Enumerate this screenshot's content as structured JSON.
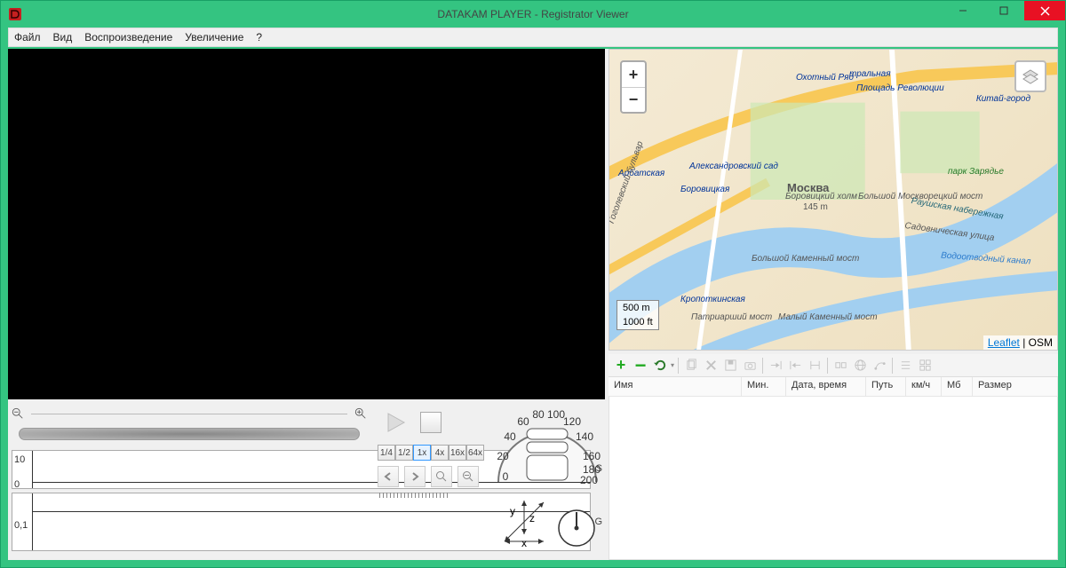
{
  "window": {
    "title": "DATAKAM PLAYER - Registrator Viewer"
  },
  "menu": {
    "items": [
      "Файл",
      "Вид",
      "Воспроизведение",
      "Увеличение",
      "?"
    ]
  },
  "playback": {
    "speeds": [
      "1/4",
      "1/2",
      "1x",
      "4x",
      "16x",
      "64x"
    ],
    "active_speed_index": 2
  },
  "speedometer": {
    "ticks": [
      "0",
      "20",
      "40",
      "60",
      "80",
      "100",
      "120",
      "140",
      "160",
      "180",
      "200"
    ]
  },
  "axes": {
    "x": "x",
    "y": "y",
    "z": "z"
  },
  "graphs": {
    "s": {
      "label": "S",
      "y_ticks": [
        "10",
        "0"
      ]
    },
    "g": {
      "label": "G",
      "y_ticks": [
        "0,1"
      ]
    }
  },
  "map": {
    "zoom_in": "+",
    "zoom_out": "−",
    "scale_metric": "500 m",
    "scale_imperial": "1000 ft",
    "attribution_link": "Leaflet",
    "attribution_sep": " | ",
    "attribution_text": "OSM",
    "labels": {
      "ohotny": "Охотный Ряд",
      "tralnaya": "тральная",
      "revolution": "Площадь Революции",
      "kitay": "Китай-город",
      "arbat": "Арбатская",
      "aleks": "Александровский сад",
      "borov": "Боровицкая",
      "moscow": "Москва",
      "borhill": "Боровицкий холм",
      "borhill_h": "145 m",
      "bolshmosk": "Большой Москворецкий мост",
      "raush": "Раушская набережная",
      "zaryadye": "парк Зарядье",
      "sadov": "Садовническая улица",
      "vodoot": "Водоотводный канал",
      "kropot": "Кропоткинская",
      "bolshkam": "Большой Каменный мост",
      "patr": "Патриарший мост",
      "malkam": "Малый Каменный мост",
      "gogol": "Гоголевский бульвар"
    }
  },
  "toolbar": {
    "add": "+",
    "remove": "−"
  },
  "columns": {
    "name": "Имя",
    "min": "Мин.",
    "datetime": "Дата, время",
    "path": "Путь",
    "kmh": "км/ч",
    "mb": "Мб",
    "size": "Размер"
  }
}
